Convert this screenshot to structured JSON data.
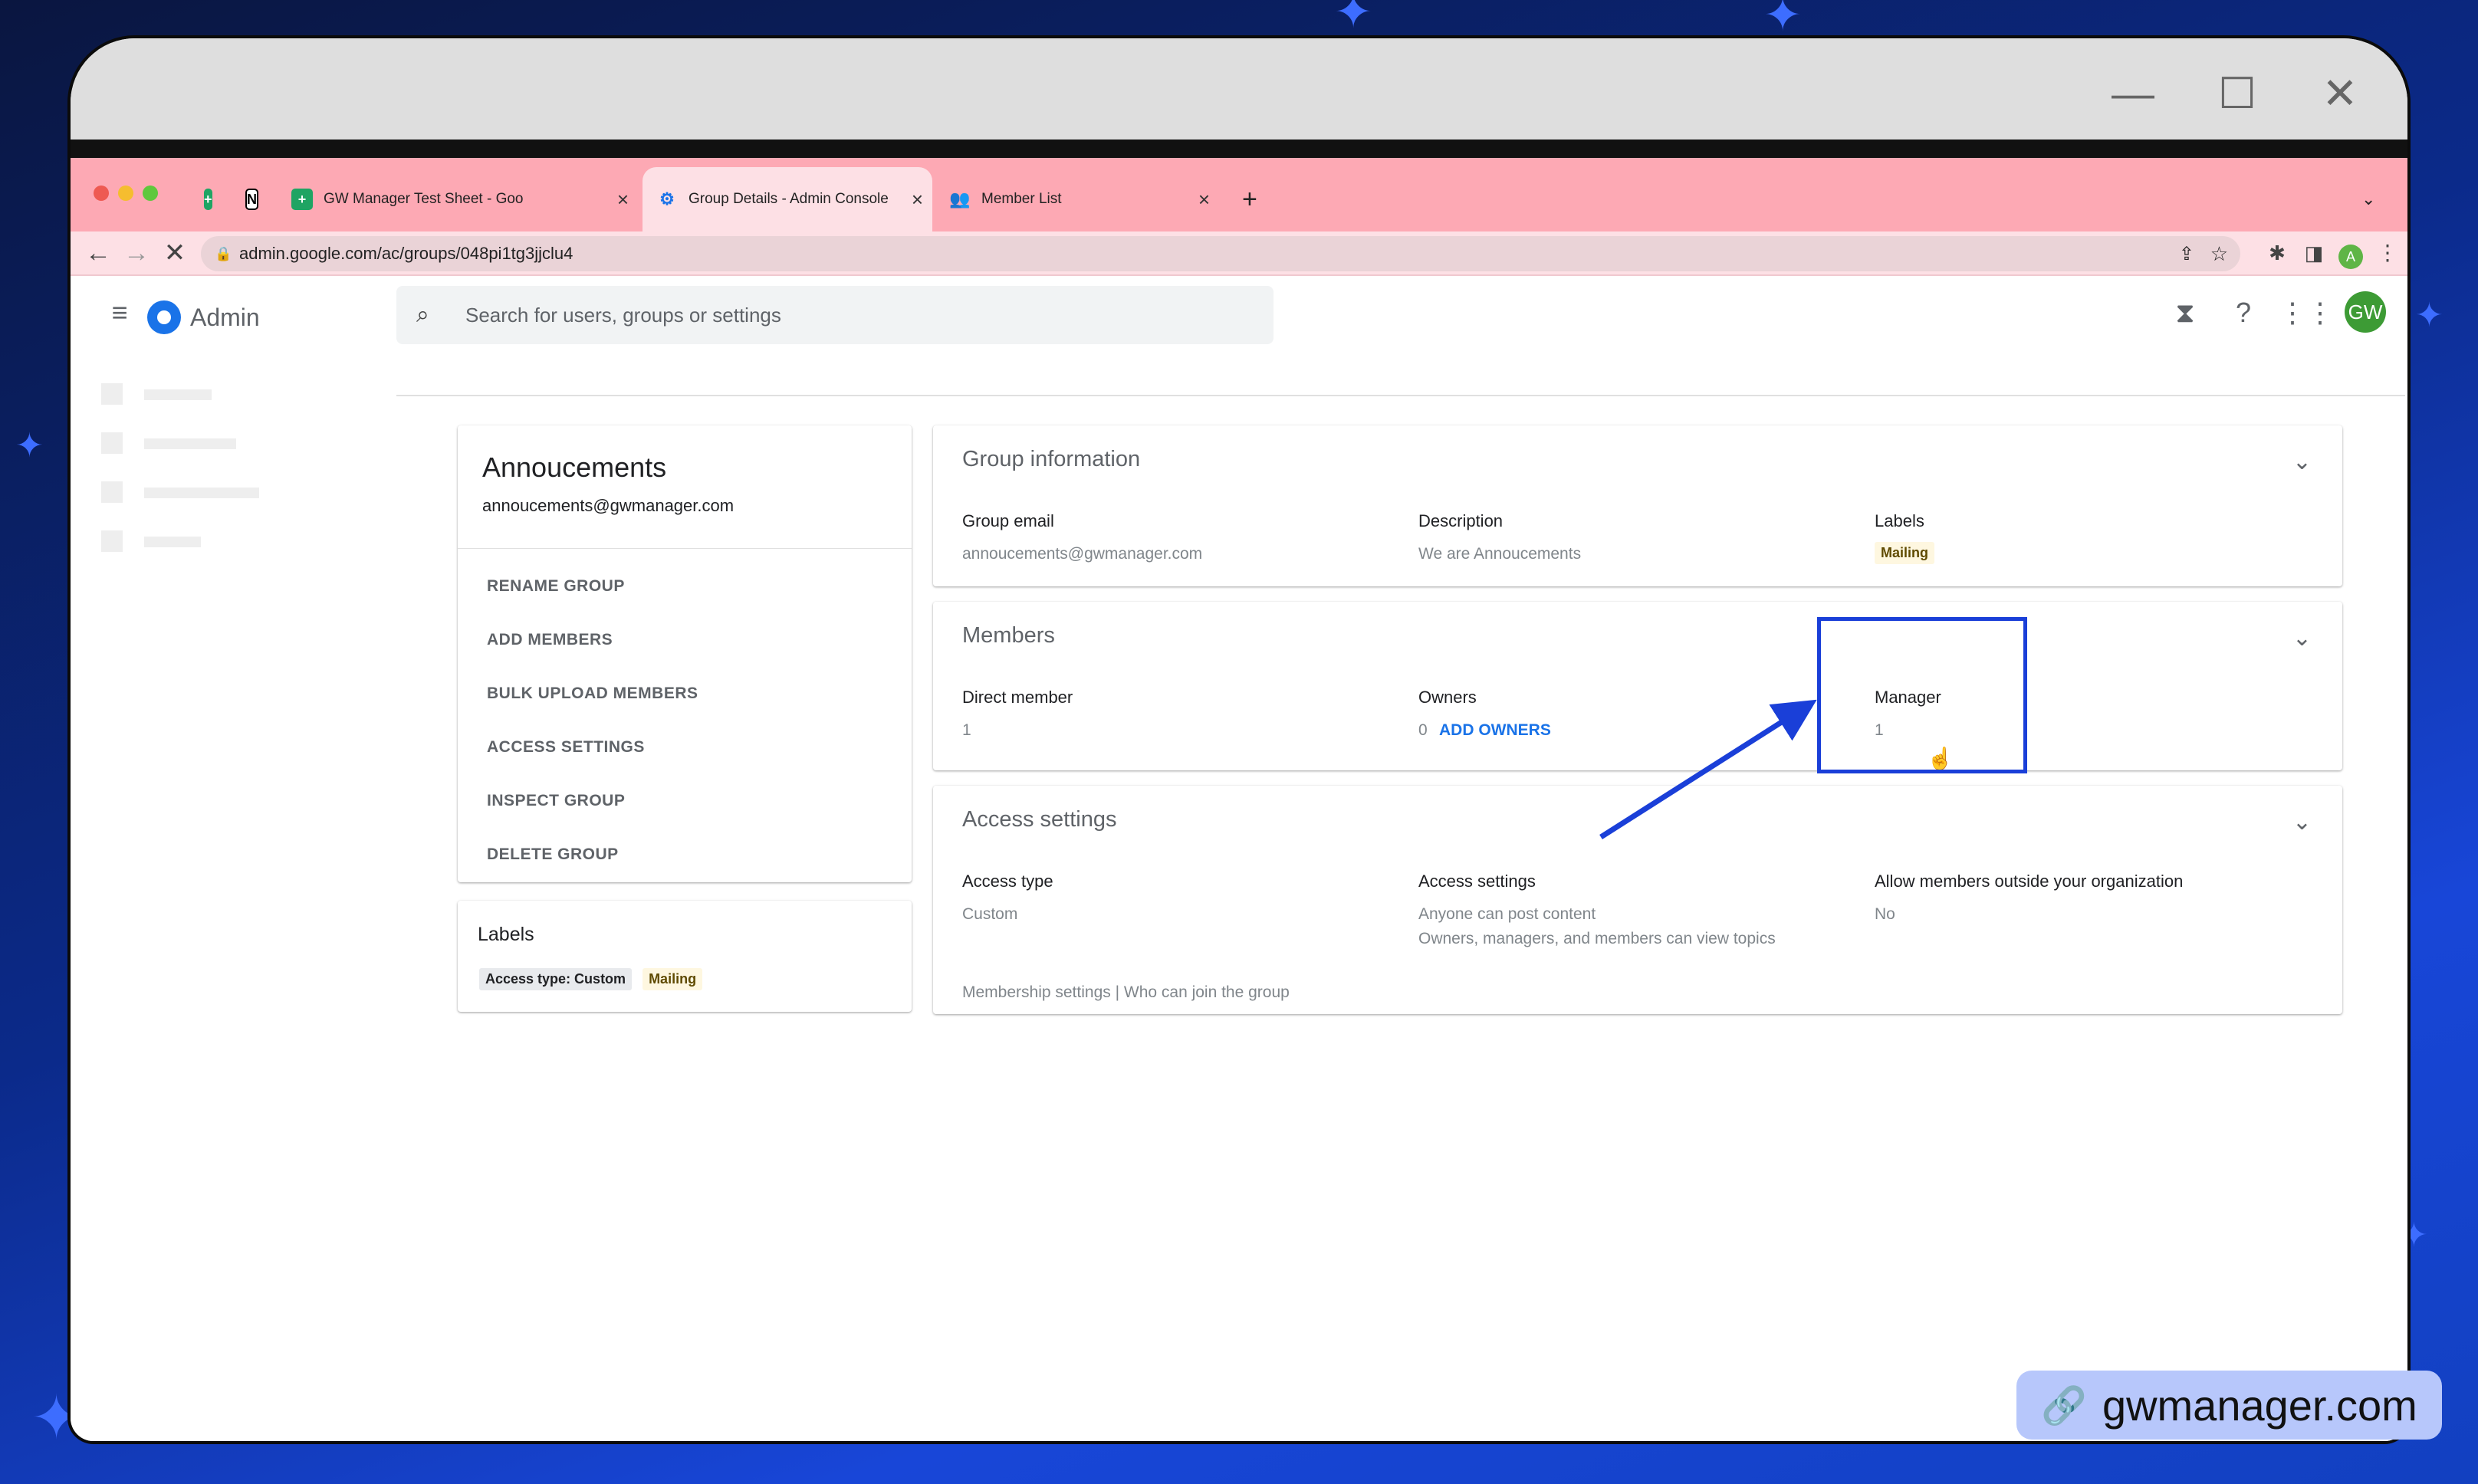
{
  "window": {
    "minimize": "—",
    "maximize": "☐",
    "close": "✕"
  },
  "tabs": [
    {
      "label": "GW Manager Test Sheet - Goo",
      "icon": "google-sheets-icon"
    },
    {
      "label": "Group Details - Admin Console",
      "icon": "admin-console-icon"
    },
    {
      "label": "Member List",
      "icon": "people-icon"
    }
  ],
  "address": {
    "url": "admin.google.com/ac/groups/048pi1tg3jjclu4"
  },
  "header": {
    "app_name": "Admin",
    "search_placeholder": "Search for users, groups or settings",
    "avatar_initials": "GW",
    "profile_initial": "A"
  },
  "group": {
    "name": "Annoucements",
    "email": "annoucements@gwmanager.com",
    "actions": [
      "RENAME GROUP",
      "ADD MEMBERS",
      "BULK UPLOAD MEMBERS",
      "ACCESS SETTINGS",
      "INSPECT GROUP",
      "DELETE GROUP"
    ],
    "labels_title": "Labels",
    "labels": [
      "Access type: Custom",
      "Mailing"
    ]
  },
  "group_info": {
    "title": "Group information",
    "email_label": "Group email",
    "email_value": "annoucements@gwmanager.com",
    "description_label": "Description",
    "description_value": "We are Annoucements",
    "labels_label": "Labels",
    "labels_value": "Mailing"
  },
  "members": {
    "title": "Members",
    "direct_label": "Direct member",
    "direct_value": "1",
    "owners_label": "Owners",
    "owners_value": "0",
    "add_owners": "ADD OWNERS",
    "manager_label": "Manager",
    "manager_value": "1"
  },
  "access": {
    "title": "Access settings",
    "type_label": "Access type",
    "type_value": "Custom",
    "settings_label": "Access settings",
    "settings_value_1": "Anyone can post content",
    "settings_value_2": "Owners, managers, and members can view topics",
    "outside_label": "Allow members outside your organization",
    "outside_value": "No",
    "footer": "Membership settings | Who can join the group"
  },
  "brand": {
    "text": "gwmanager.com"
  },
  "colors": {
    "tab_strip": "#fda9b4",
    "accent_blue": "#1a3fd8",
    "link_blue": "#1a73e8",
    "chip_mailing": "#fef7e0",
    "avatar_green": "#3d9b35"
  }
}
